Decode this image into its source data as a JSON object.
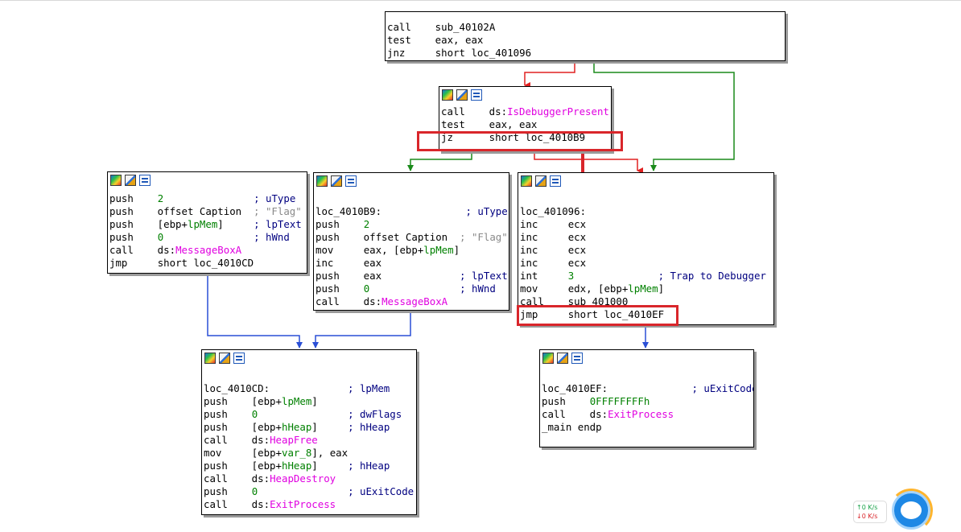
{
  "blocks": {
    "top": {
      "lines": [
        {
          "tokens": [
            {
              "t": "call",
              "c": ""
            },
            {
              "t": "    sub_40102A",
              "c": ""
            }
          ]
        },
        {
          "tokens": [
            {
              "t": "test",
              "c": ""
            },
            {
              "t": "    eax, eax",
              "c": ""
            }
          ]
        },
        {
          "tokens": [
            {
              "t": "jnz",
              "c": ""
            },
            {
              "t": "     short loc_401096",
              "c": ""
            }
          ]
        }
      ]
    },
    "isdbg": {
      "lines": [
        {
          "tokens": [
            {
              "t": "call",
              "c": ""
            },
            {
              "t": "    ds:",
              "c": ""
            },
            {
              "t": "IsDebuggerPresent",
              "c": "imp"
            }
          ]
        },
        {
          "tokens": [
            {
              "t": "test",
              "c": ""
            },
            {
              "t": "    eax, eax",
              "c": ""
            }
          ]
        },
        {
          "tokens": [
            {
              "t": "jz",
              "c": ""
            },
            {
              "t": "      short loc_4010B9",
              "c": ""
            }
          ]
        }
      ]
    },
    "msgleft": {
      "lines": [
        {
          "tokens": [
            {
              "t": "push",
              "c": ""
            },
            {
              "t": "    ",
              "c": ""
            },
            {
              "t": "2",
              "c": "num"
            },
            {
              "t": "               ",
              "c": ""
            },
            {
              "t": "; uType",
              "c": "cm"
            }
          ]
        },
        {
          "tokens": [
            {
              "t": "push",
              "c": ""
            },
            {
              "t": "    offset Caption  ",
              "c": ""
            },
            {
              "t": "; \"Flag\"",
              "c": "str"
            }
          ]
        },
        {
          "tokens": [
            {
              "t": "push",
              "c": ""
            },
            {
              "t": "    [ebp+",
              "c": ""
            },
            {
              "t": "lpMem",
              "c": "var"
            },
            {
              "t": "]     ",
              "c": ""
            },
            {
              "t": "; lpText",
              "c": "cm"
            }
          ]
        },
        {
          "tokens": [
            {
              "t": "push",
              "c": ""
            },
            {
              "t": "    ",
              "c": ""
            },
            {
              "t": "0",
              "c": "num"
            },
            {
              "t": "               ",
              "c": ""
            },
            {
              "t": "; hWnd",
              "c": "cm"
            }
          ]
        },
        {
          "tokens": [
            {
              "t": "call",
              "c": ""
            },
            {
              "t": "    ds:",
              "c": ""
            },
            {
              "t": "MessageBoxA",
              "c": "imp"
            }
          ]
        },
        {
          "tokens": [
            {
              "t": "jmp",
              "c": ""
            },
            {
              "t": "     short loc_4010CD",
              "c": ""
            }
          ]
        }
      ]
    },
    "loc4010b9": {
      "lines": [
        {
          "tokens": [
            {
              "t": "",
              "c": ""
            }
          ]
        },
        {
          "tokens": [
            {
              "t": "loc_4010B9:",
              "c": ""
            },
            {
              "t": "              ",
              "c": ""
            },
            {
              "t": "; uType",
              "c": "cm"
            }
          ]
        },
        {
          "tokens": [
            {
              "t": "push",
              "c": ""
            },
            {
              "t": "    ",
              "c": ""
            },
            {
              "t": "2",
              "c": "num"
            }
          ]
        },
        {
          "tokens": [
            {
              "t": "push",
              "c": ""
            },
            {
              "t": "    offset Caption  ",
              "c": ""
            },
            {
              "t": "; \"Flag\"",
              "c": "str"
            }
          ]
        },
        {
          "tokens": [
            {
              "t": "mov",
              "c": ""
            },
            {
              "t": "     eax, [ebp+",
              "c": ""
            },
            {
              "t": "lpMem",
              "c": "var"
            },
            {
              "t": "]",
              "c": ""
            }
          ]
        },
        {
          "tokens": [
            {
              "t": "inc",
              "c": ""
            },
            {
              "t": "     eax",
              "c": ""
            }
          ]
        },
        {
          "tokens": [
            {
              "t": "push",
              "c": ""
            },
            {
              "t": "    eax             ",
              "c": ""
            },
            {
              "t": "; lpText",
              "c": "cm"
            }
          ]
        },
        {
          "tokens": [
            {
              "t": "push",
              "c": ""
            },
            {
              "t": "    ",
              "c": ""
            },
            {
              "t": "0",
              "c": "num"
            },
            {
              "t": "               ",
              "c": ""
            },
            {
              "t": "; hWnd",
              "c": "cm"
            }
          ]
        },
        {
          "tokens": [
            {
              "t": "call",
              "c": ""
            },
            {
              "t": "    ds:",
              "c": ""
            },
            {
              "t": "MessageBoxA",
              "c": "imp"
            }
          ]
        }
      ]
    },
    "loc401096": {
      "lines": [
        {
          "tokens": [
            {
              "t": "",
              "c": ""
            }
          ]
        },
        {
          "tokens": [
            {
              "t": "loc_401096:",
              "c": ""
            }
          ]
        },
        {
          "tokens": [
            {
              "t": "inc",
              "c": ""
            },
            {
              "t": "     ecx",
              "c": ""
            }
          ]
        },
        {
          "tokens": [
            {
              "t": "inc",
              "c": ""
            },
            {
              "t": "     ecx",
              "c": ""
            }
          ]
        },
        {
          "tokens": [
            {
              "t": "inc",
              "c": ""
            },
            {
              "t": "     ecx",
              "c": ""
            }
          ]
        },
        {
          "tokens": [
            {
              "t": "inc",
              "c": ""
            },
            {
              "t": "     ecx",
              "c": ""
            }
          ]
        },
        {
          "tokens": [
            {
              "t": "int",
              "c": ""
            },
            {
              "t": "     ",
              "c": ""
            },
            {
              "t": "3",
              "c": "num"
            },
            {
              "t": "              ",
              "c": ""
            },
            {
              "t": "; Trap to Debugger",
              "c": "cm"
            }
          ]
        },
        {
          "tokens": [
            {
              "t": "mov",
              "c": ""
            },
            {
              "t": "     edx, [ebp+",
              "c": ""
            },
            {
              "t": "lpMem",
              "c": "var"
            },
            {
              "t": "]",
              "c": ""
            }
          ]
        },
        {
          "tokens": [
            {
              "t": "call",
              "c": ""
            },
            {
              "t": "    sub_401000",
              "c": ""
            }
          ]
        },
        {
          "tokens": [
            {
              "t": "jmp",
              "c": ""
            },
            {
              "t": "     short loc_4010EF",
              "c": ""
            }
          ]
        }
      ]
    },
    "loc4010cd": {
      "lines": [
        {
          "tokens": [
            {
              "t": "",
              "c": ""
            }
          ]
        },
        {
          "tokens": [
            {
              "t": "loc_4010CD:",
              "c": ""
            },
            {
              "t": "             ",
              "c": ""
            },
            {
              "t": "; lpMem",
              "c": "cm"
            }
          ]
        },
        {
          "tokens": [
            {
              "t": "push",
              "c": ""
            },
            {
              "t": "    [ebp+",
              "c": ""
            },
            {
              "t": "lpMem",
              "c": "var"
            },
            {
              "t": "]",
              "c": ""
            }
          ]
        },
        {
          "tokens": [
            {
              "t": "push",
              "c": ""
            },
            {
              "t": "    ",
              "c": ""
            },
            {
              "t": "0",
              "c": "num"
            },
            {
              "t": "               ",
              "c": ""
            },
            {
              "t": "; dwFlags",
              "c": "cm"
            }
          ]
        },
        {
          "tokens": [
            {
              "t": "push",
              "c": ""
            },
            {
              "t": "    [ebp+",
              "c": ""
            },
            {
              "t": "hHeap",
              "c": "var"
            },
            {
              "t": "]     ",
              "c": ""
            },
            {
              "t": "; hHeap",
              "c": "cm"
            }
          ]
        },
        {
          "tokens": [
            {
              "t": "call",
              "c": ""
            },
            {
              "t": "    ds:",
              "c": ""
            },
            {
              "t": "HeapFree",
              "c": "imp"
            }
          ]
        },
        {
          "tokens": [
            {
              "t": "mov",
              "c": ""
            },
            {
              "t": "     [ebp+",
              "c": ""
            },
            {
              "t": "var_8",
              "c": "var"
            },
            {
              "t": "], eax",
              "c": ""
            }
          ]
        },
        {
          "tokens": [
            {
              "t": "push",
              "c": ""
            },
            {
              "t": "    [ebp+",
              "c": ""
            },
            {
              "t": "hHeap",
              "c": "var"
            },
            {
              "t": "]     ",
              "c": ""
            },
            {
              "t": "; hHeap",
              "c": "cm"
            }
          ]
        },
        {
          "tokens": [
            {
              "t": "call",
              "c": ""
            },
            {
              "t": "    ds:",
              "c": ""
            },
            {
              "t": "HeapDestroy",
              "c": "imp"
            }
          ]
        },
        {
          "tokens": [
            {
              "t": "push",
              "c": ""
            },
            {
              "t": "    ",
              "c": ""
            },
            {
              "t": "0",
              "c": "num"
            },
            {
              "t": "               ",
              "c": ""
            },
            {
              "t": "; uExitCode",
              "c": "cm"
            }
          ]
        },
        {
          "tokens": [
            {
              "t": "call",
              "c": ""
            },
            {
              "t": "    ds:",
              "c": ""
            },
            {
              "t": "ExitProcess",
              "c": "imp"
            }
          ]
        }
      ]
    },
    "loc4010ef": {
      "lines": [
        {
          "tokens": [
            {
              "t": "",
              "c": ""
            }
          ]
        },
        {
          "tokens": [
            {
              "t": "loc_4010EF:",
              "c": ""
            },
            {
              "t": "              ",
              "c": ""
            },
            {
              "t": "; uExitCode",
              "c": "cm"
            }
          ]
        },
        {
          "tokens": [
            {
              "t": "push",
              "c": ""
            },
            {
              "t": "    ",
              "c": ""
            },
            {
              "t": "0FFFFFFFFh",
              "c": "num"
            }
          ]
        },
        {
          "tokens": [
            {
              "t": "call",
              "c": ""
            },
            {
              "t": "    ds:",
              "c": ""
            },
            {
              "t": "ExitProcess",
              "c": "imp"
            }
          ]
        },
        {
          "tokens": [
            {
              "t": "_main endp",
              "c": ""
            }
          ]
        }
      ]
    }
  },
  "tray": {
    "up": "↑0  K/s",
    "down": "↓0  K/s"
  },
  "colors": {
    "highlight": "#d9262b",
    "edge_true": "#1a8a1a",
    "edge_false": "#e02020",
    "edge_uncond": "#2a4fd6",
    "import": "#e000e0",
    "number": "#008000",
    "comment": "#000080"
  }
}
